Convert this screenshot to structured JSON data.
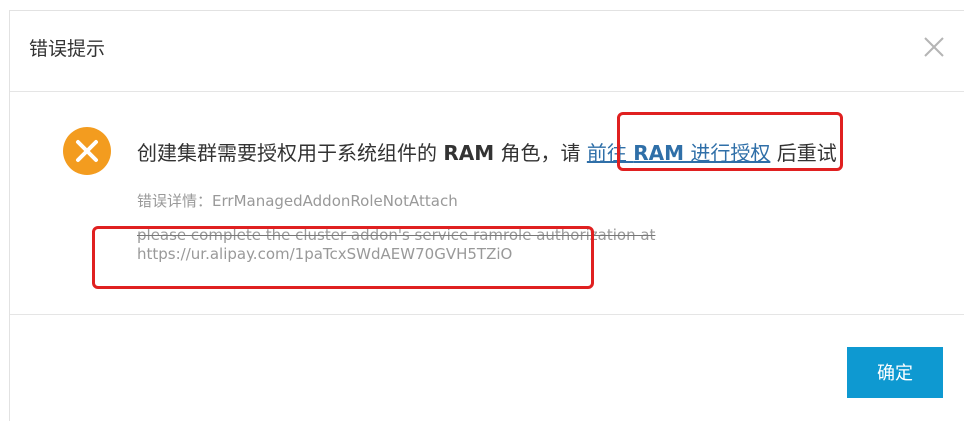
{
  "dialog": {
    "title": "错误提示",
    "message": {
      "prefix": "创建集群需要授权用于系统组件的 ",
      "ram": "RAM",
      "middle": " 角色，请 ",
      "link_prefix": "前往 ",
      "link_ram": "RAM",
      "link_suffix": " 进行授权",
      "suffix": " 后重试"
    },
    "detail_label": "错误详情：",
    "detail_code": "ErrManagedAddonRoleNotAttach",
    "detail_line1": "please complete the cluster addon's service ramrole authorization at",
    "detail_url": "https://ur.alipay.com/1paTcxSWdAEW70GVH5TZiO",
    "confirm_label": "确定"
  },
  "colors": {
    "error_icon": "#f39c1f",
    "link": "#2f6fa8",
    "confirm_button": "#0e99d1",
    "annotation_box": "#e02020"
  },
  "icons": {
    "close": "close-icon",
    "error": "error-circle-x-icon"
  }
}
